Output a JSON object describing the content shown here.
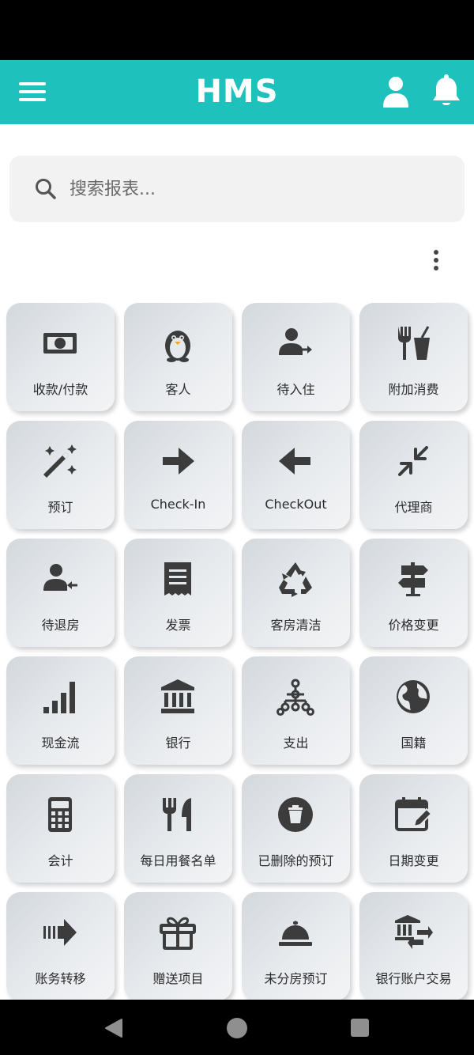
{
  "app_bar": {
    "title": "HMS",
    "background": "#1fc1bd",
    "icons": [
      "menu-icon",
      "user-icon",
      "bell-icon"
    ]
  },
  "search": {
    "placeholder": "搜索报表...",
    "value": ""
  },
  "tiles": [
    {
      "label": "收款/付款",
      "icon": "money-bill-icon"
    },
    {
      "label": "客人",
      "icon": "penguin-icon"
    },
    {
      "label": "待入住",
      "icon": "user-arrow-right-icon"
    },
    {
      "label": "附加消费",
      "icon": "utensils-drink-icon"
    },
    {
      "label": "预订",
      "icon": "magic-wand-icon"
    },
    {
      "label": "Check-In",
      "icon": "arrow-right-icon"
    },
    {
      "label": "CheckOut",
      "icon": "arrow-left-icon"
    },
    {
      "label": "代理商",
      "icon": "compress-arrows-icon"
    },
    {
      "label": "待退房",
      "icon": "user-arrow-left-icon"
    },
    {
      "label": "发票",
      "icon": "receipt-icon"
    },
    {
      "label": "客房清洁",
      "icon": "recycle-icon"
    },
    {
      "label": "价格变更",
      "icon": "signpost-icon"
    },
    {
      "label": "现金流",
      "icon": "signal-bars-icon"
    },
    {
      "label": "银行",
      "icon": "bank-icon"
    },
    {
      "label": "支出",
      "icon": "sitemap-icon"
    },
    {
      "label": "国籍",
      "icon": "globe-icon"
    },
    {
      "label": "会计",
      "icon": "calculator-icon"
    },
    {
      "label": "每日用餐名单",
      "icon": "fork-knife-icon"
    },
    {
      "label": "已删除的预订",
      "icon": "trash-circle-icon"
    },
    {
      "label": "日期变更",
      "icon": "calendar-edit-icon"
    },
    {
      "label": "账务转移",
      "icon": "transfer-arrow-icon"
    },
    {
      "label": "赠送项目",
      "icon": "gift-icon"
    },
    {
      "label": "未分房预订",
      "icon": "concierge-bell-icon"
    },
    {
      "label": "银行账户交易",
      "icon": "bank-exchange-icon"
    }
  ]
}
